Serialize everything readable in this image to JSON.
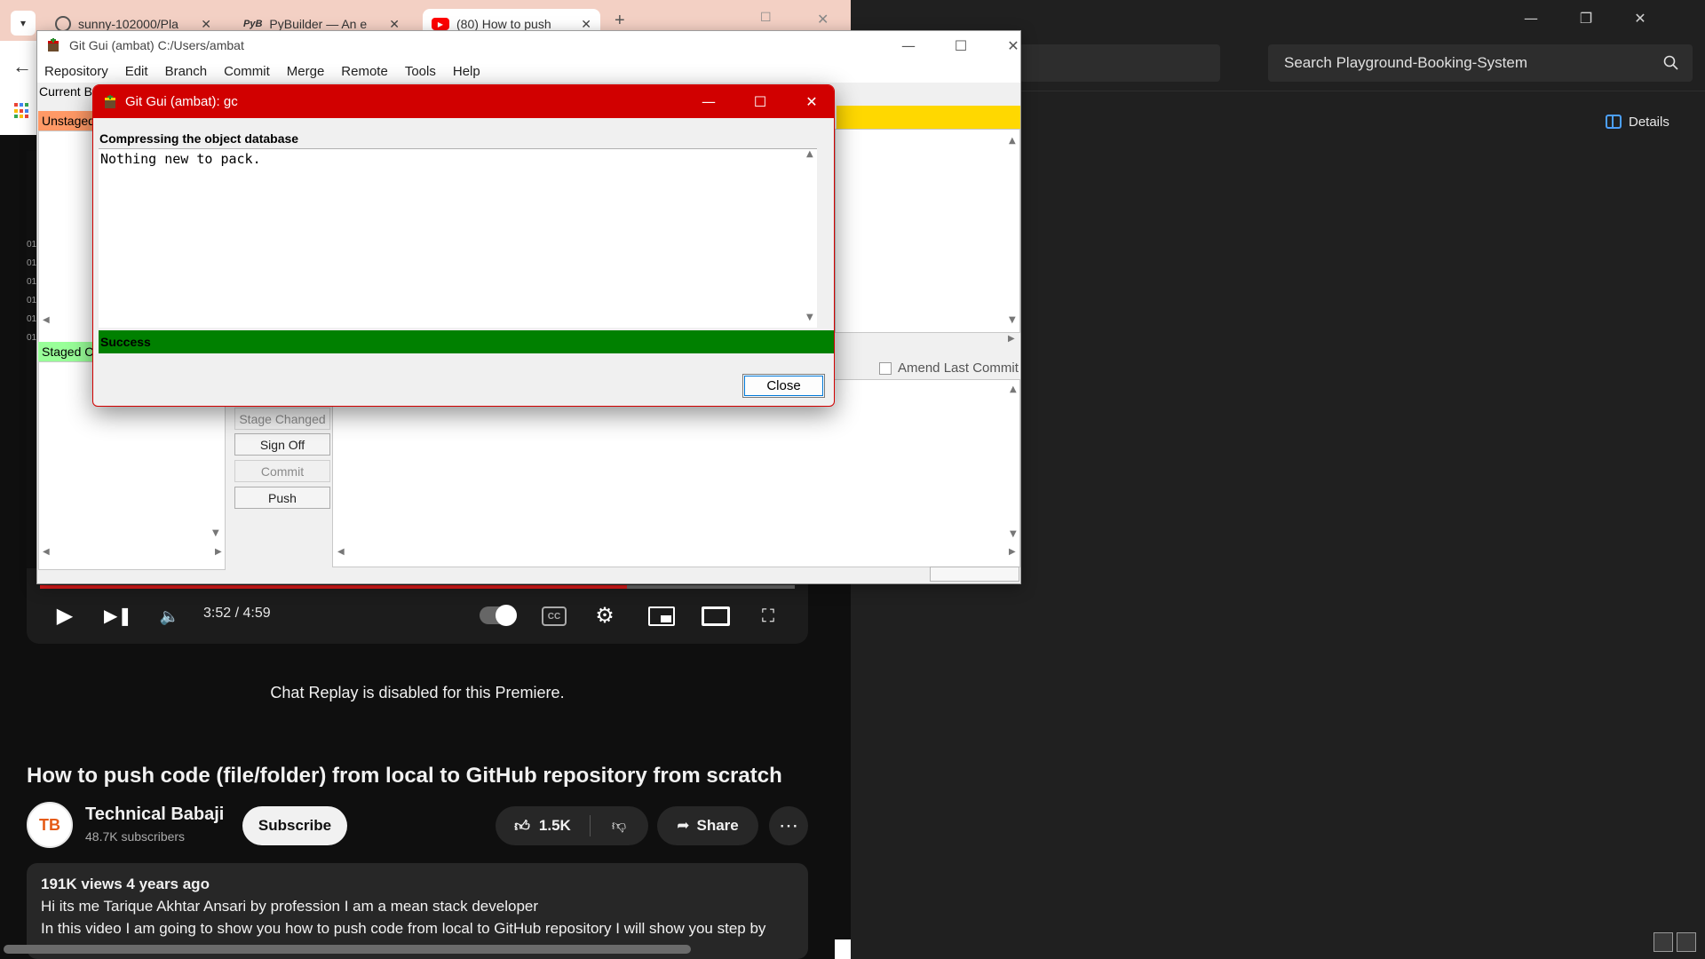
{
  "browser": {
    "tabs": [
      {
        "label": "sunny-102000/Pla",
        "icon": "github-icon"
      },
      {
        "label": "PyBuilder — An e",
        "icon": "pybuilder-icon"
      },
      {
        "label": "(80) How to push",
        "icon": "youtube-icon"
      }
    ],
    "new_tab": "+",
    "pyb_badge": "PyB"
  },
  "right_app": {
    "search_placeholder": "Search Playground-Booking-System",
    "details_label": "Details"
  },
  "gitgui": {
    "title": "Git Gui (ambat) C:/Users/ambat",
    "menu": [
      "Repository",
      "Edit",
      "Branch",
      "Commit",
      "Merge",
      "Remote",
      "Tools",
      "Help"
    ],
    "current_branch_label": "Current B",
    "unstaged_label": "Unstaged",
    "staged_label": "Staged C",
    "buttons": {
      "stage_changed": "Stage Changed",
      "sign_off": "Sign Off",
      "commit": "Commit",
      "push": "Push"
    },
    "amend_label": "Amend Last Commit",
    "left_gutter_digits": [
      "01",
      "01",
      "01",
      "01",
      "01",
      "01",
      "01",
      "01"
    ]
  },
  "gc_dialog": {
    "title": "Git Gui (ambat): gc",
    "heading": "Compressing the object database",
    "output": "Nothing new to pack.",
    "status": "Success",
    "close_label": "Close"
  },
  "youtube": {
    "time": "3:52 / 4:59",
    "progress_fraction": 0.778,
    "chat_replay": "Chat Replay is disabled for this Premiere.",
    "title": "How to push code (file/folder) from local to GitHub repository from scratch",
    "channel": "Technical Babaji",
    "subscribers": "48.7K subscribers",
    "subscribe": "Subscribe",
    "likes": "1.5K",
    "share": "Share",
    "avatar_text": "TB",
    "views_line": "191K views  4 years ago",
    "desc_line1": "Hi its me Tarique Akhtar Ansari by profession I am a mean stack developer",
    "desc_line2": "In this video I am going to show you how to push code from local to GitHub repository I will show you step by"
  },
  "colors": {
    "gc_titlebar": "#d10000",
    "success": "#008000",
    "unstaged": "#ff9966",
    "staged": "#99ff99",
    "yt_progress": "#e21b1b"
  }
}
